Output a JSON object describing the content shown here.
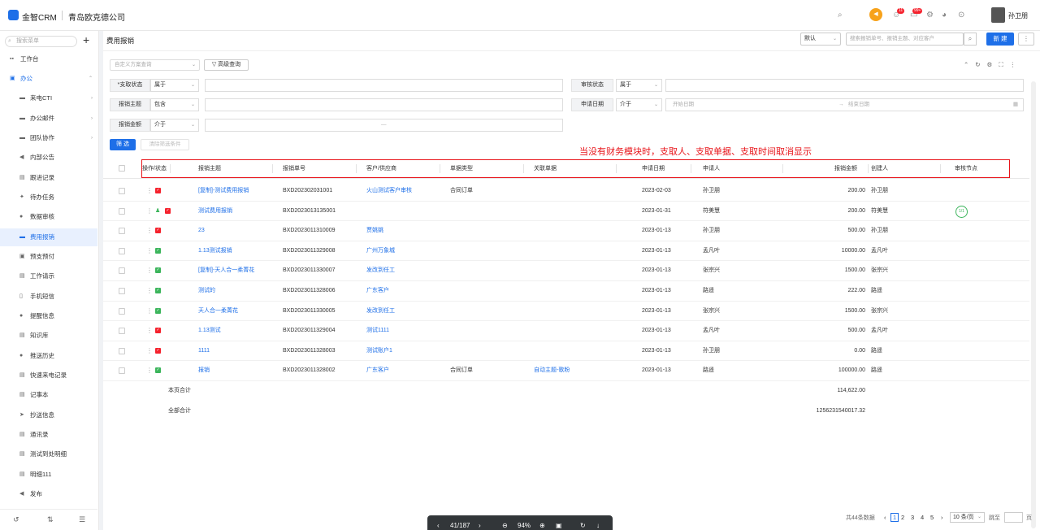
{
  "app": {
    "name": "金智CRM",
    "company": "青岛欧克德公司",
    "user": "孙卫朋"
  },
  "badges": {
    "contacts": "11",
    "messages": "99+"
  },
  "accent": "#1e6fe8",
  "sidebar": {
    "search_placeholder": "搜索菜单",
    "items": [
      {
        "label": "工作台",
        "icon": "dashboard-icon"
      },
      {
        "label": "办公",
        "icon": "office-icon"
      },
      {
        "label": "来电CTI",
        "icon": "phone-icon"
      },
      {
        "label": "办公邮件",
        "icon": "mail-icon"
      },
      {
        "label": "团队协作",
        "icon": "team-icon"
      },
      {
        "label": "内部公告",
        "icon": "megaphone-icon"
      },
      {
        "label": "跟进记录",
        "icon": "record-icon"
      },
      {
        "label": "待办任务",
        "icon": "pin-icon"
      },
      {
        "label": "数据审核",
        "icon": "user-icon"
      },
      {
        "label": "费用报销",
        "icon": "card-icon"
      },
      {
        "label": "预支预付",
        "icon": "wallet-icon"
      },
      {
        "label": "工作请示",
        "icon": "doc-icon"
      },
      {
        "label": "手机短信",
        "icon": "sms-icon"
      },
      {
        "label": "提醒信息",
        "icon": "bell-icon"
      },
      {
        "label": "知识库",
        "icon": "book-icon"
      },
      {
        "label": "推送历史",
        "icon": "history-icon"
      },
      {
        "label": "快速来电记录",
        "icon": "quick-icon"
      },
      {
        "label": "记事本",
        "icon": "notebook-icon"
      },
      {
        "label": "抄送信息",
        "icon": "send-icon"
      },
      {
        "label": "通讯录",
        "icon": "contacts-icon"
      },
      {
        "label": "测试到处明细",
        "icon": "list-icon"
      },
      {
        "label": "明细111",
        "icon": "list-icon"
      },
      {
        "label": "发布",
        "icon": "publish-icon"
      }
    ]
  },
  "page": {
    "title": "费用报销",
    "view_select": "默认",
    "search_placeholder": "搜索报销单号、报销主题、对应客户",
    "new_label": "新 建"
  },
  "filters": {
    "custom_query_placeholder": "自定义方案查询",
    "advanced_label": "高级查询",
    "rows": [
      {
        "label": "*支取状态",
        "op": "属于"
      },
      {
        "label": "审核状态",
        "op": "属于"
      },
      {
        "label": "报销主题",
        "op": "包含"
      },
      {
        "label": "申请日期",
        "op": "介于",
        "start": "开始日期",
        "sep": "→",
        "end": "结束日期"
      },
      {
        "label": "报销金额",
        "op": "介于",
        "range_sep": "—"
      }
    ],
    "filter_btn": "筛 选",
    "clear_btn": "清除筛选条件"
  },
  "annotation": "当没有财务模块时，支取人、支取单据、支取时间取消显示",
  "table": {
    "columns": [
      "操作/状态",
      "报销主题",
      "报销单号",
      "客户/供应商",
      "单据类型",
      "关联单据",
      "申请日期",
      "申请人",
      "报销金额",
      "创建人",
      "审核节点"
    ],
    "rows": [
      {
        "status": "red",
        "subject": "[复制]-测试费用报销",
        "no": "BXD202302031001",
        "customer": "火山测试客户审核",
        "type": "合同订单",
        "related": "",
        "date": "2023-02-03",
        "applicant": "孙卫朋",
        "amount": "200.00",
        "creator": "孙卫朋",
        "node": ""
      },
      {
        "status": "red",
        "person": true,
        "subject": "测试费用报销",
        "no": "BXD2023013135001",
        "customer": "",
        "type": "",
        "related": "",
        "date": "2023-01-31",
        "applicant": "符美慧",
        "amount": "200.00",
        "creator": "符美慧",
        "node": "1/1"
      },
      {
        "status": "red",
        "subject": "23",
        "no": "BXD2023011310009",
        "customer": "贾姚姚",
        "type": "",
        "related": "",
        "date": "2023-01-13",
        "applicant": "孙卫朋",
        "amount": "500.00",
        "creator": "孙卫朋",
        "node": ""
      },
      {
        "status": "green",
        "subject": "1.13测试报销",
        "no": "BXD2023011329008",
        "customer": "广州万象城",
        "type": "",
        "related": "",
        "date": "2023-01-13",
        "applicant": "孟凡叶",
        "amount": "10000.00",
        "creator": "孟凡叶",
        "node": ""
      },
      {
        "status": "green",
        "subject": "[复制]-天人合一柔菁花",
        "no": "BXD2023011330007",
        "customer": "发改到任工",
        "type": "",
        "related": "",
        "date": "2023-01-13",
        "applicant": "张宗兴",
        "amount": "1500.00",
        "creator": "张宗兴",
        "node": ""
      },
      {
        "status": "green",
        "subject": "测试的",
        "no": "BXD2023011328006",
        "customer": "广东客户",
        "type": "",
        "related": "",
        "date": "2023-01-13",
        "applicant": "路遥",
        "amount": "222.00",
        "creator": "路遥",
        "node": ""
      },
      {
        "status": "green",
        "subject": "天人合一柔菁花",
        "no": "BXD2023011330005",
        "customer": "发改到任工",
        "type": "",
        "related": "",
        "date": "2023-01-13",
        "applicant": "张宗兴",
        "amount": "1500.00",
        "creator": "张宗兴",
        "node": ""
      },
      {
        "status": "red",
        "subject": "1.13测试",
        "no": "BXD2023011329004",
        "customer": "测试1111",
        "type": "",
        "related": "",
        "date": "2023-01-13",
        "applicant": "孟凡叶",
        "amount": "500.00",
        "creator": "孟凡叶",
        "node": ""
      },
      {
        "status": "red",
        "subject": "1111",
        "no": "BXD2023011328003",
        "customer": "测试账户1",
        "type": "",
        "related": "",
        "date": "2023-01-13",
        "applicant": "孙卫朋",
        "amount": "0.00",
        "creator": "路遥",
        "node": ""
      },
      {
        "status": "green",
        "subject": "报销",
        "no": "BXD2023011328002",
        "customer": "广东客户",
        "type": "合同订单",
        "related": "自动主题-歌粉",
        "date": "2023-01-13",
        "applicant": "路遥",
        "amount": "100000.00",
        "creator": "路遥",
        "node": ""
      }
    ],
    "page_total_label": "本页合计",
    "page_total": "114,622.00",
    "all_total_label": "全部合计",
    "all_total": "1256231540017.32"
  },
  "pagination": {
    "total": "共44条数据",
    "pages": [
      "1",
      "2",
      "3",
      "4",
      "5"
    ],
    "size": "10 条/页",
    "jump": "跳至",
    "unit": "页"
  },
  "viewer": {
    "page": "41/187",
    "zoom": "94%"
  }
}
